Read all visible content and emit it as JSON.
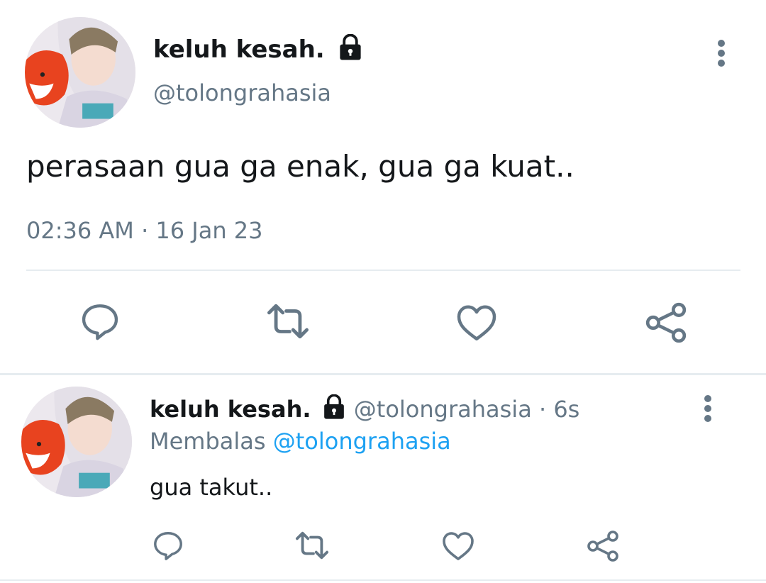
{
  "tweet": {
    "display_name": "keluh kesah.",
    "handle": "@tolongrahasia",
    "text": "perasaan gua ga enak, gua ga kuat..",
    "time": "02:36 AM",
    "date_sep": " · ",
    "date": "16 Jan 23"
  },
  "reply": {
    "display_name": "keluh kesah.",
    "handle": "@tolongrahasia",
    "age_sep": " · ",
    "age": "6s",
    "replying_label": "Membalas",
    "replying_to": "@tolongrahasia",
    "text": "gua takut.."
  },
  "icons": {
    "lock": "lock-icon",
    "more": "more-vertical-icon",
    "reply": "reply-icon",
    "retweet": "retweet-icon",
    "like": "like-icon",
    "share": "share-icon"
  },
  "colors": {
    "text": "#14171a",
    "secondary": "#657786",
    "link": "#1da1f2",
    "divider": "#e6ecf0"
  }
}
